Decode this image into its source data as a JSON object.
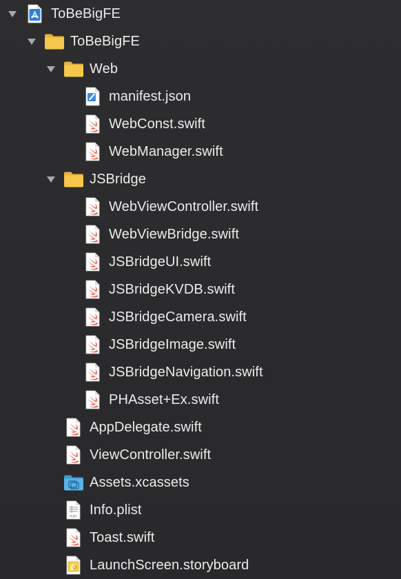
{
  "project": {
    "name": "ToBeBigFE",
    "icon": "xcode-project-icon"
  },
  "tree": [
    {
      "label": "ToBeBigFE",
      "level": 0,
      "type": "project",
      "expanded": true,
      "icon": "xcode-project-icon"
    },
    {
      "label": "ToBeBigFE",
      "level": 1,
      "type": "folder",
      "expanded": true,
      "icon": "folder-icon"
    },
    {
      "label": "Web",
      "level": 2,
      "type": "folder",
      "expanded": true,
      "icon": "folder-icon"
    },
    {
      "label": "manifest.json",
      "level": 3,
      "type": "json",
      "icon": "json-file-icon"
    },
    {
      "label": "WebConst.swift",
      "level": 3,
      "type": "swift",
      "icon": "swift-file-icon"
    },
    {
      "label": "WebManager.swift",
      "level": 3,
      "type": "swift",
      "icon": "swift-file-icon"
    },
    {
      "label": "JSBridge",
      "level": 2,
      "type": "folder",
      "expanded": true,
      "icon": "folder-icon"
    },
    {
      "label": "WebViewController.swift",
      "level": 3,
      "type": "swift",
      "icon": "swift-file-icon"
    },
    {
      "label": "WebViewBridge.swift",
      "level": 3,
      "type": "swift",
      "icon": "swift-file-icon"
    },
    {
      "label": "JSBridgeUI.swift",
      "level": 3,
      "type": "swift",
      "icon": "swift-file-icon"
    },
    {
      "label": "JSBridgeKVDB.swift",
      "level": 3,
      "type": "swift",
      "icon": "swift-file-icon"
    },
    {
      "label": "JSBridgeCamera.swift",
      "level": 3,
      "type": "swift",
      "icon": "swift-file-icon"
    },
    {
      "label": "JSBridgeImage.swift",
      "level": 3,
      "type": "swift",
      "icon": "swift-file-icon"
    },
    {
      "label": "JSBridgeNavigation.swift",
      "level": 3,
      "type": "swift",
      "icon": "swift-file-icon"
    },
    {
      "label": "PHAsset+Ex.swift",
      "level": 3,
      "type": "swift",
      "icon": "swift-file-icon"
    },
    {
      "label": "AppDelegate.swift",
      "level": 2,
      "type": "swift",
      "icon": "swift-file-icon"
    },
    {
      "label": "ViewController.swift",
      "level": 2,
      "type": "swift",
      "icon": "swift-file-icon"
    },
    {
      "label": "Assets.xcassets",
      "level": 2,
      "type": "assets",
      "icon": "asset-catalog-icon"
    },
    {
      "label": "Info.plist",
      "level": 2,
      "type": "plist",
      "icon": "plist-file-icon"
    },
    {
      "label": "Toast.swift",
      "level": 2,
      "type": "swift",
      "icon": "swift-file-icon"
    },
    {
      "label": "LaunchScreen.storyboard",
      "level": 2,
      "type": "storyboard",
      "icon": "storyboard-file-icon"
    }
  ],
  "colors": {
    "background": "#2b2b2d",
    "text": "#ececec",
    "folder": "#f5c84c",
    "swift": "#f05138",
    "project_blue": "#2f7fd8",
    "assets_blue": "#59b4e8"
  }
}
